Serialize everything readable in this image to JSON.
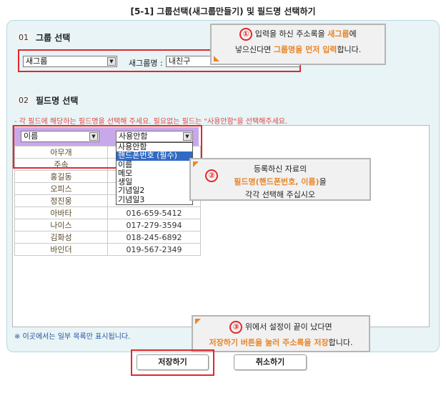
{
  "page_title": "[5-1] 그룹선택(새그룹만들기) 및 필드명 선택하기",
  "section1": {
    "number": "01",
    "title": "그룹 선택",
    "group_select_value": "새그룹",
    "group_name_label": "새그룹명 :",
    "group_name_value": "내친구"
  },
  "section2": {
    "number": "02",
    "title": "필드명 선택",
    "notice": "- 각 필드에 해당하는 필드명을 선택해 주세요. 필요없는 필드는 \"사용안함\"을 선택해주세요.",
    "field_select_1": "이름",
    "field_select_2": "사용안함",
    "dropdown_options": [
      "사용안함",
      "핸드폰번호 (필수)",
      "이름",
      "메모",
      "생일",
      "기념일2",
      "기념일3"
    ],
    "dropdown_selected_index": 1,
    "rows": [
      [
        "아무개",
        ""
      ],
      [
        "주속",
        ""
      ],
      [
        "홍길동",
        ""
      ],
      [
        "오피스",
        ""
      ],
      [
        "정진웅",
        ""
      ],
      [
        "아바타",
        "016-659-5412"
      ],
      [
        "나이스",
        "017-279-3594"
      ],
      [
        "김화성",
        "018-245-6892"
      ],
      [
        "바인더",
        "019-567-2349"
      ]
    ]
  },
  "callouts": {
    "c1": {
      "num": "①",
      "line1_pre": "입력을 하신 주소록을 ",
      "line1_hl": "새그룹",
      "line1_post": "에",
      "line2_pre": "넣으신다면 ",
      "line2_hl": "그룹명을 먼저 입력",
      "line2_post": "합니다."
    },
    "c2": {
      "num": "②",
      "line1": "등록하신 자료의",
      "line2_hl": "필드명(핸드폰번호, 이름)",
      "line2_post": "을",
      "line3": "각각 선택해 주십시오"
    },
    "c3": {
      "num": "③",
      "line1": "위에서 설정이 끝이 났다면",
      "line2_hl": "저장하기 버튼을 눌러 주소록을 저장",
      "line2_post": "합니다."
    }
  },
  "footer_note": "※ 이곳에서는 일부 목록만 표시됩니다.",
  "buttons": {
    "save": "저장하기",
    "cancel": "취소하기"
  },
  "colors": {
    "accent_red": "#e0282d",
    "highlight_orange": "#e8862a",
    "panel_bg": "#e8f4f6",
    "header_purple": "#c9a8ea"
  }
}
